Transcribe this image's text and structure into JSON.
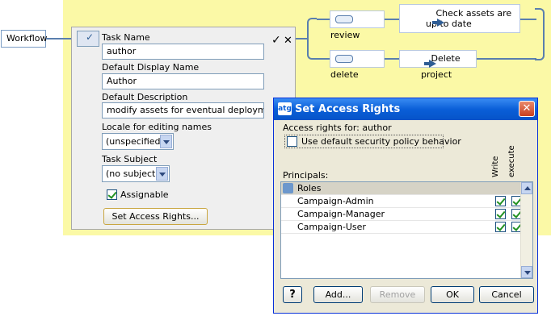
{
  "workflow": {
    "root_label": "Workflow",
    "outcomes": [
      {
        "label": "review",
        "action": "Check assets are up to date"
      },
      {
        "label": "delete",
        "action": "Delete project"
      }
    ]
  },
  "task_panel": {
    "confirm_glyph": "✓",
    "cancel_glyph": "✕",
    "task_name_label": "Task Name",
    "task_name_value": "author",
    "display_name_label": "Default Display Name",
    "display_name_value": "Author",
    "description_label": "Default Description",
    "description_value": "modify assets for eventual deployment",
    "locale_label": "Locale for editing names",
    "locale_value": "(unspecified)",
    "subject_label": "Task Subject",
    "subject_value": "(no subject)",
    "assignable_label": "Assignable",
    "assignable_checked": true,
    "set_access_button": "Set Access Rights..."
  },
  "dialog": {
    "app_badge": "atg",
    "title": "Set Access Rights",
    "close_glyph": "✕",
    "access_for_label": "Access rights for:",
    "access_for_value": "author",
    "default_policy_label": "Use default security policy behavior",
    "default_policy_checked": false,
    "principals_label": "Principals:",
    "columns": [
      "Write",
      "execute"
    ],
    "group_header": "Roles",
    "principals": [
      {
        "name": "Campaign-Admin",
        "write": true,
        "execute": true
      },
      {
        "name": "Campaign-Manager",
        "write": true,
        "execute": true
      },
      {
        "name": "Campaign-User",
        "write": true,
        "execute": true
      }
    ],
    "buttons": {
      "help": "?",
      "add": "Add...",
      "remove": "Remove",
      "ok": "OK",
      "cancel": "Cancel"
    }
  },
  "colors": {
    "canvas": "#fbf9a6",
    "titlebar": "#0a5fd8",
    "check": "#219121"
  }
}
